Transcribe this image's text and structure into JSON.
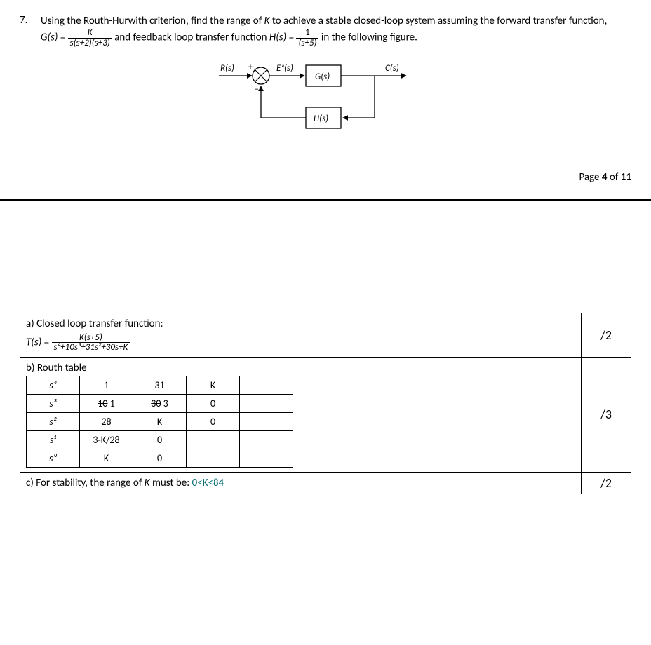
{
  "question": {
    "number": "7.",
    "pre": "Using the Routh-Hurwith criterion, find the range of ",
    "kvar": "K",
    "mid1": " to achieve a stable closed-loop system assuming the forward transfer function, ",
    "g_lhs": "G(s) = ",
    "g_num": "K",
    "g_den": "s(s+2)(s+3)",
    "mid2": " and feedback loop transfer function ",
    "h_lhs": "H(s) = ",
    "h_num": "1",
    "h_den": "(s+5)",
    "tail": " in the following figure."
  },
  "diagram": {
    "R": "R(s)",
    "plus": "+",
    "minus": "−",
    "Ea": "Eₐ(s)",
    "G": "G(s)",
    "C": "C(s)",
    "H": "H(s)"
  },
  "pageinfo": {
    "pre": "Page ",
    "cur": "4",
    "of": " of ",
    "tot": "11"
  },
  "partA": {
    "title": "a) Closed loop transfer function:",
    "lhs": "T(s) = ",
    "num": "K(s+5)",
    "den": "s⁴+10s³+31s²+30s+K",
    "score": "/2"
  },
  "partB": {
    "title": "b) Routh table",
    "rows": [
      {
        "p": "s⁴",
        "c1": "1",
        "c2": "31",
        "c3": "K",
        "c4": ""
      },
      {
        "p": "s³",
        "c1": "10 1",
        "c2": "30 3",
        "c3": "0",
        "c4": ""
      },
      {
        "p": "s²",
        "c1": "28",
        "c2": "K",
        "c3": "0",
        "c4": ""
      },
      {
        "p": "s¹",
        "c1": "3-K/28",
        "c2": "0",
        "c3": "",
        "c4": ""
      },
      {
        "p": "s⁰",
        "c1": "K",
        "c2": "0",
        "c3": "",
        "c4": ""
      }
    ],
    "score": "/3"
  },
  "partC": {
    "pre": "c) For stability, the range of ",
    "k": "K",
    "mid": " must be: ",
    "ans": "0<K<84",
    "score": "/2"
  }
}
